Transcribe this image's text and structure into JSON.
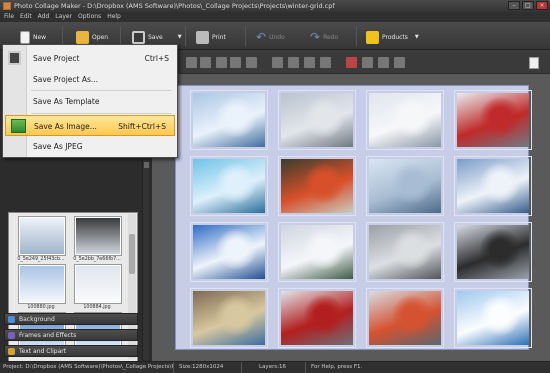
{
  "window": {
    "title": "Photo Collage Maker - D:\\Dropbox (AMS Software)\\Photos\\_Collage Projects\\Projects\\winter-grid.cpf"
  },
  "menubar": [
    "File",
    "Edit",
    "Add",
    "Layer",
    "Options",
    "Help"
  ],
  "toolbar": {
    "new": "New",
    "open": "Open",
    "save": "Save",
    "print": "Print",
    "undo": "Undo",
    "redo": "Redo",
    "products": "Products"
  },
  "save_menu": {
    "items": [
      {
        "label": "Save Project",
        "shortcut": "Ctrl+S"
      },
      {
        "label": "Save Project As...",
        "shortcut": ""
      },
      {
        "label": "Save As Template",
        "shortcut": ""
      },
      {
        "label": "Save As Image...",
        "shortcut": "Shift+Ctrl+S"
      },
      {
        "label": "Save As JPEG",
        "shortcut": ""
      }
    ]
  },
  "thumbnails": [
    {
      "name": "0_5e249_25f43cb..."
    },
    {
      "name": "0_5e2bb_7e66fb7..."
    },
    {
      "name": "100880.jpg"
    },
    {
      "name": "100884.jpg"
    },
    {
      "name": "1341207328800.jpg"
    },
    {
      "name": "239099.jpg"
    }
  ],
  "panel_sections": [
    {
      "label": "Background",
      "color": "#4a8fd8"
    },
    {
      "label": "Frames and Effects",
      "color": "#7a5fc0"
    },
    {
      "label": "Text and Clipart",
      "color": "#d8a030"
    }
  ],
  "status": {
    "path": "Project: D:\\Dropbox (AMS Software)\\Photos\\_Collage Projects\\Pro...",
    "size": "Size:1280x1024",
    "layers": "Layers:16",
    "help": "For Help, press F1."
  },
  "colors": {
    "highlight": "#ffc750",
    "page_bg": "#c7cde6"
  },
  "photos": [
    {
      "subject": "snowy forest",
      "colors": [
        "#aac6e4",
        "#eaf2fb",
        "#3f6d9c"
      ]
    },
    {
      "subject": "misty winter lake",
      "colors": [
        "#b9c3cf",
        "#e2e6ea",
        "#6f7883"
      ]
    },
    {
      "subject": "frosted trees",
      "colors": [
        "#dfe6ee",
        "#f6f7f9",
        "#8a97a6"
      ]
    },
    {
      "subject": "red berries in snow",
      "colors": [
        "#e9ecf0",
        "#c02a2a",
        "#707a85"
      ]
    },
    {
      "subject": "frozen river",
      "colors": [
        "#6fc3e8",
        "#ddf0fb",
        "#2b6e9a"
      ]
    },
    {
      "subject": "bullfinch on branch",
      "colors": [
        "#3a3d2d",
        "#d8502a",
        "#c8ccc0"
      ]
    },
    {
      "subject": "frosted branches",
      "colors": [
        "#d9e6f2",
        "#a8bdd3",
        "#4d6a88"
      ]
    },
    {
      "subject": "frosted tree blue sky",
      "colors": [
        "#7b9cc8",
        "#eef3f9",
        "#365c8c"
      ]
    },
    {
      "subject": "blue sky snow trees",
      "colors": [
        "#2f6cc4",
        "#eef4fb",
        "#234f90"
      ]
    },
    {
      "subject": "snowy pines path",
      "colors": [
        "#cfd6e0",
        "#f4f6f9",
        "#3e5a45"
      ]
    },
    {
      "subject": "foggy snowy tree",
      "colors": [
        "#9aa0a6",
        "#dcdfe2",
        "#4f5458"
      ]
    },
    {
      "subject": "hooded crow in snow",
      "colors": [
        "#d7dde5",
        "#2c2c2c",
        "#9aa3ad"
      ]
    },
    {
      "subject": "birdhouse with tits",
      "colors": [
        "#7f6b52",
        "#d8c8a0",
        "#3c6da0"
      ]
    },
    {
      "subject": "rowan berries",
      "colors": [
        "#e0e4ea",
        "#b31f1f",
        "#6d7078"
      ]
    },
    {
      "subject": "bullfinch in snowy branches",
      "colors": [
        "#d8dde3",
        "#d55230",
        "#5d6670"
      ]
    },
    {
      "subject": "sunlit frost",
      "colors": [
        "#9fc8ee",
        "#fbfdff",
        "#2c6fb5"
      ]
    }
  ]
}
